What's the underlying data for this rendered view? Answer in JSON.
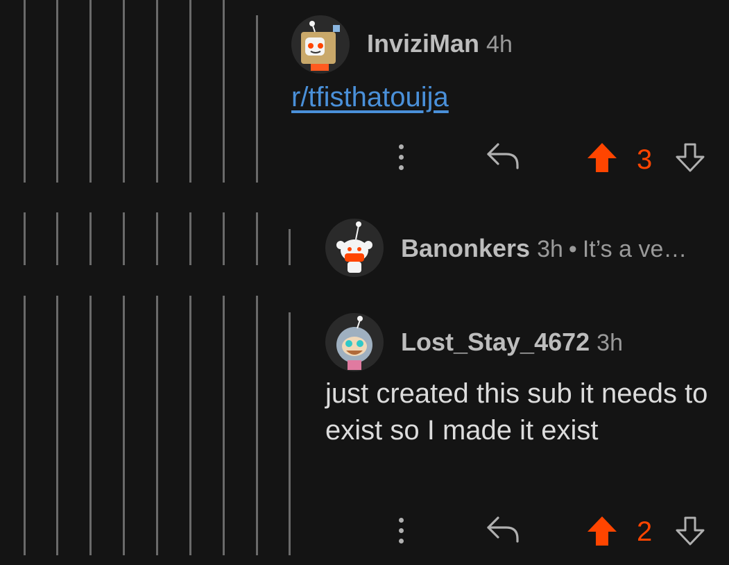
{
  "comments": [
    {
      "username": "InviziMan",
      "time": "4h",
      "link": "r/tfisthatouija",
      "score": "3"
    },
    {
      "username": "Banonkers",
      "time": "3h",
      "separator": "•",
      "preview": "It’s a ve…"
    },
    {
      "username": "Lost_Stay_4672",
      "time": "3h",
      "body": "just created this sub it needs to exist so I made it exist",
      "score": "2"
    }
  ],
  "colors": {
    "background": "#141414",
    "upvote_active": "#ff4500",
    "link": "#4a90d9",
    "thread_line": "#6a6a6a"
  },
  "icons": [
    "more-vertical-icon",
    "reply-icon",
    "upvote-arrow-icon",
    "downvote-arrow-icon",
    "snoo-avatar-icon"
  ]
}
